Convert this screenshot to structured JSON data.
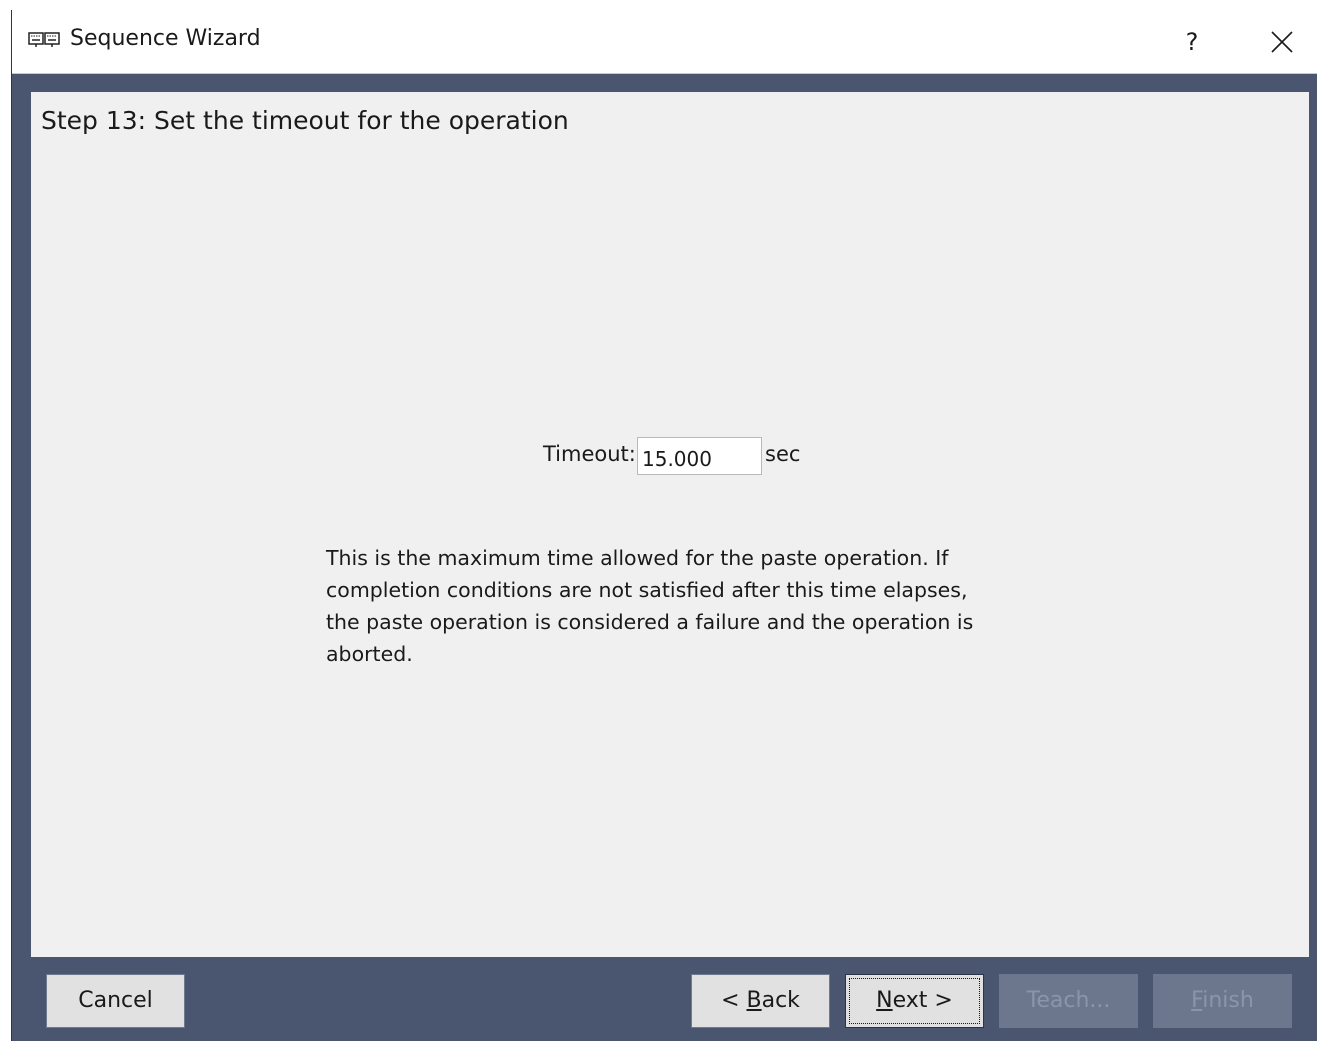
{
  "window": {
    "title": "Sequence Wizard",
    "help_label": "?",
    "icon": "keyboard-icon"
  },
  "step": {
    "title": "Step 13: Set the timeout for the operation"
  },
  "timeout": {
    "label": "Timeout:",
    "value": "15.000",
    "unit": "sec"
  },
  "description": {
    "lines": [
      "This is the maximum time allowed for the paste operation. If",
      "completion conditions are not satisfied after this time elapses,",
      "the paste operation is considered a failure and the operation is",
      "aborted."
    ]
  },
  "buttons": {
    "cancel": "Cancel",
    "back_prefix": "< ",
    "back_mnemonic": "B",
    "back_rest": "ack",
    "next_mnemonic": "N",
    "next_rest": "ext >",
    "teach": "Teach...",
    "finish_mnemonic": "F",
    "finish_rest": "inish"
  }
}
